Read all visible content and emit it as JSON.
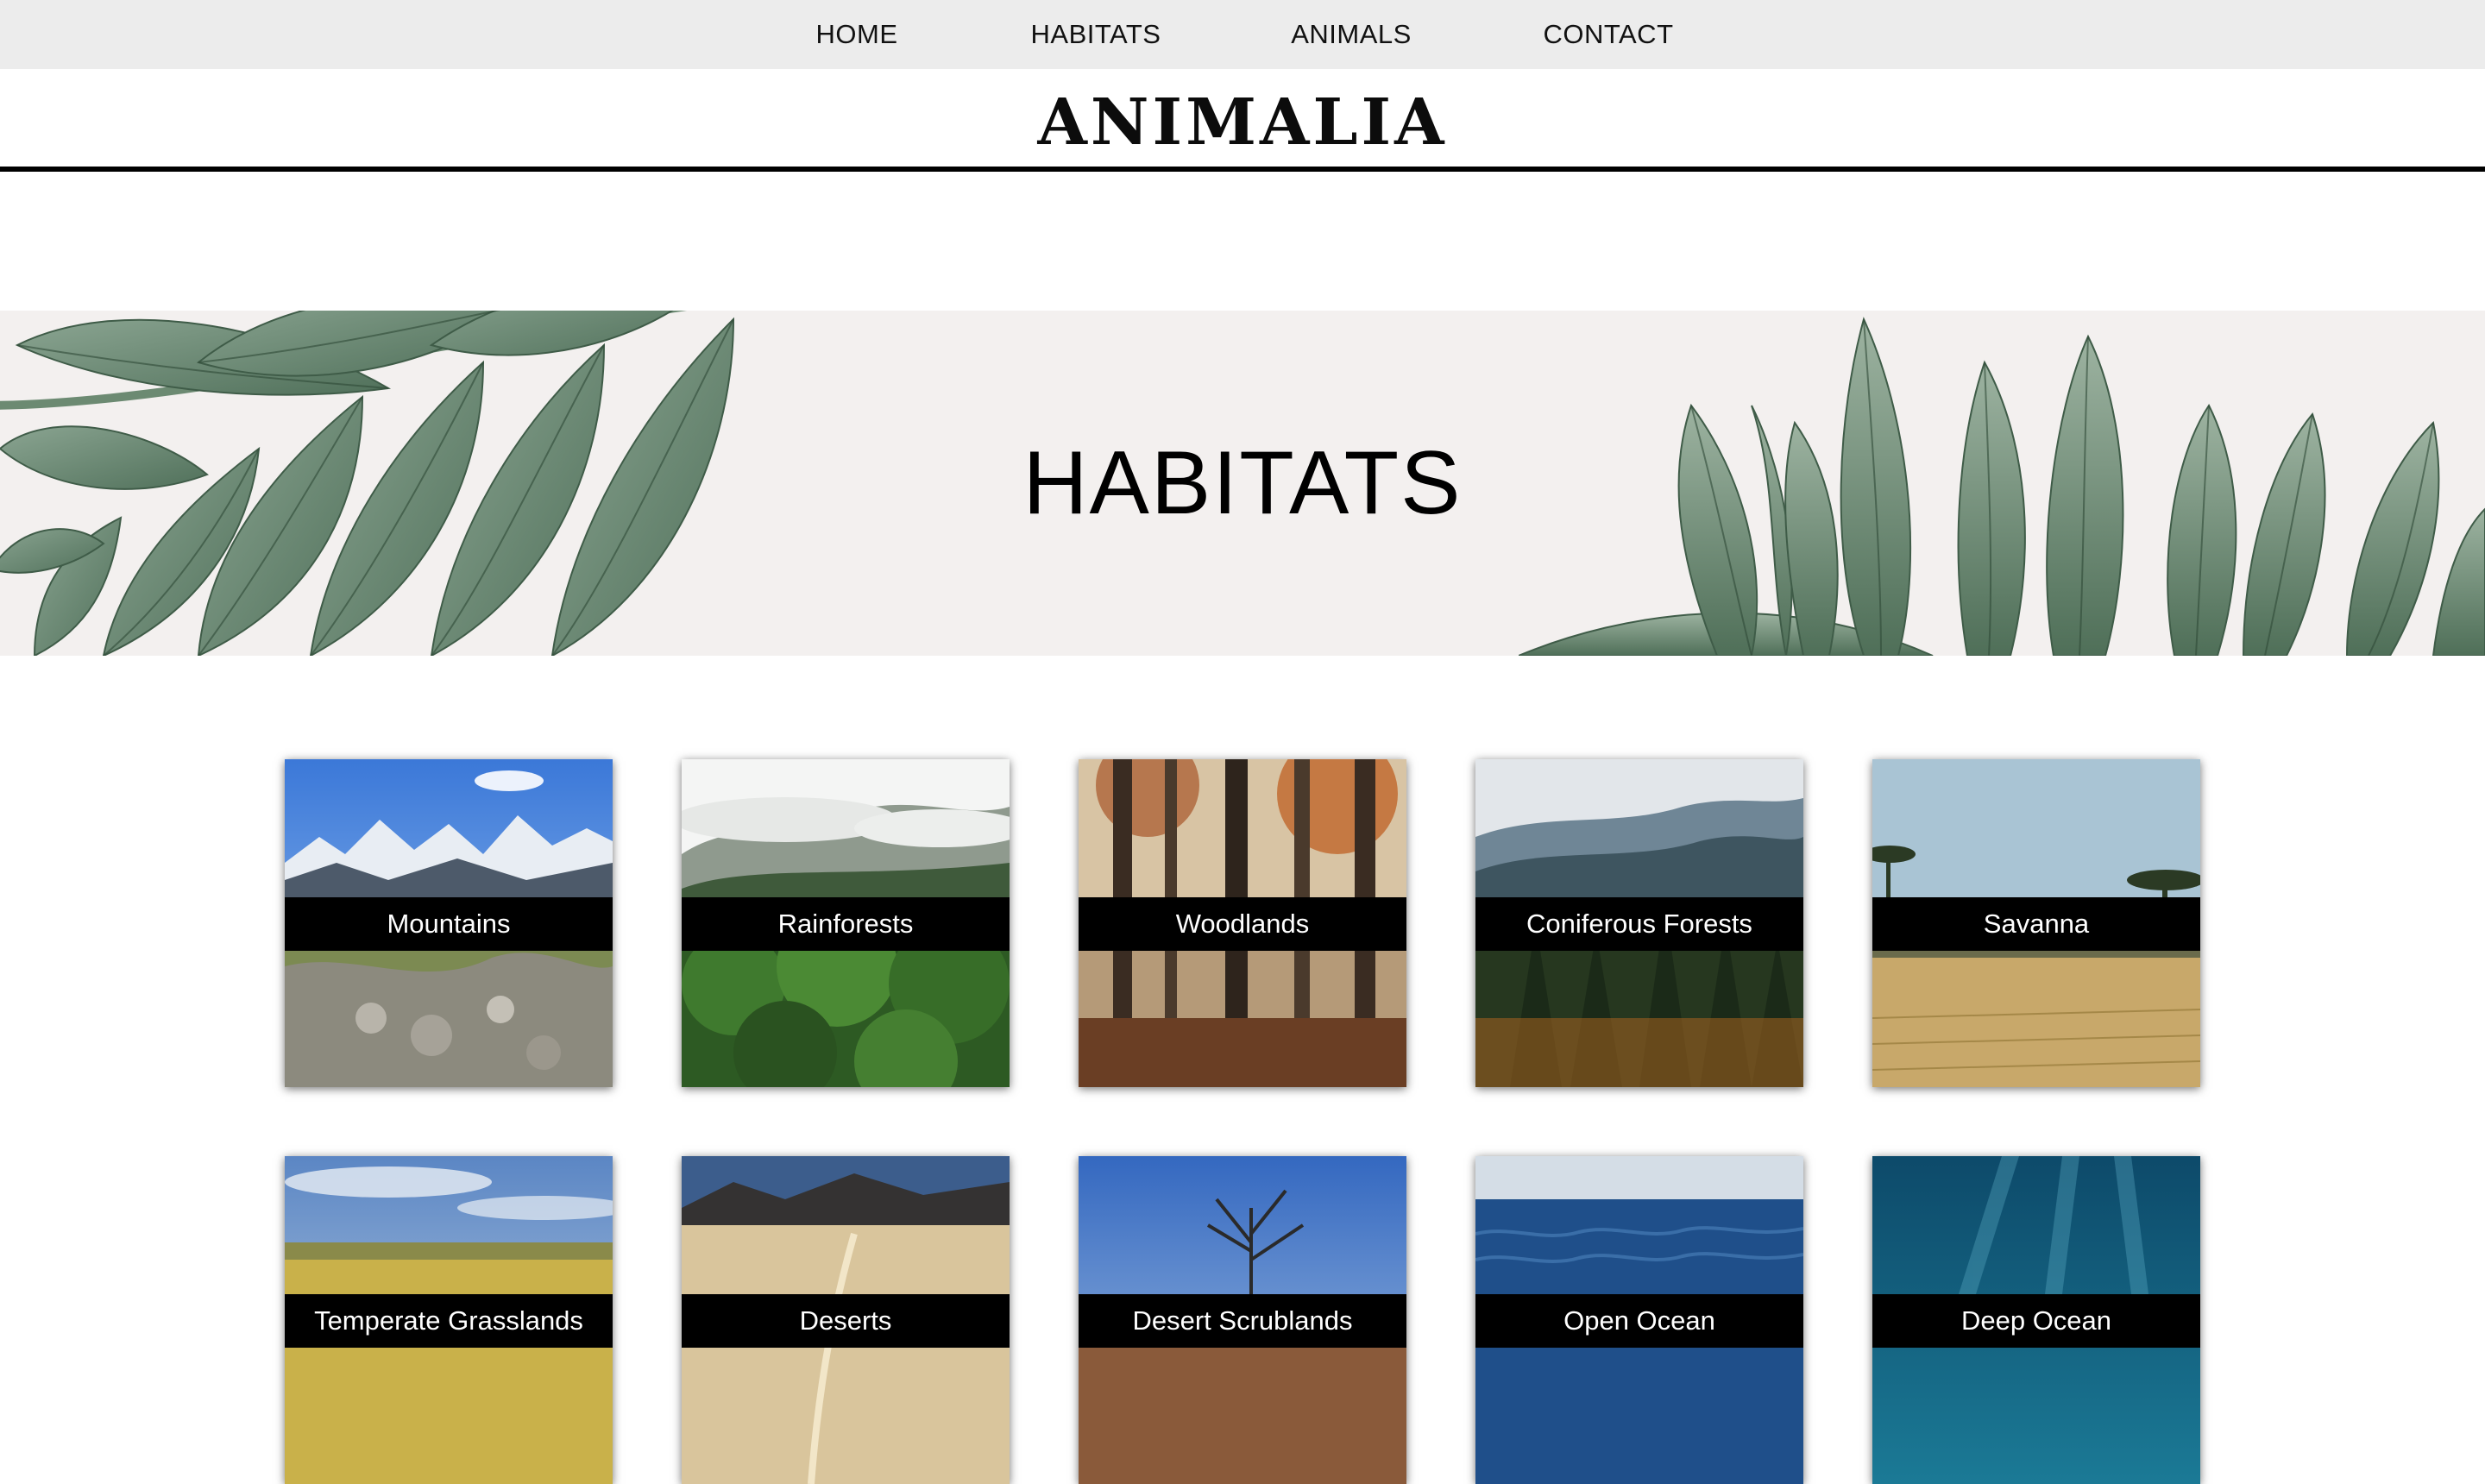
{
  "nav": {
    "items": [
      {
        "label": "HOME"
      },
      {
        "label": "HABITATS"
      },
      {
        "label": "ANIMALS"
      },
      {
        "label": "CONTACT"
      }
    ]
  },
  "header": {
    "logo": "ANIMALIA"
  },
  "hero": {
    "title": "HABITATS"
  },
  "colors": {
    "nav_bg": "#ececec",
    "hero_bg": "#f3f0ef",
    "leaf_green": "#6f8f74",
    "label_bg": "#000000",
    "label_text": "#ffffff"
  },
  "habitats": [
    {
      "label": "Mountains"
    },
    {
      "label": "Rainforests"
    },
    {
      "label": "Woodlands"
    },
    {
      "label": "Coniferous Forests"
    },
    {
      "label": "Savanna"
    },
    {
      "label": "Temperate Grasslands"
    },
    {
      "label": "Deserts"
    },
    {
      "label": "Desert Scrublands"
    },
    {
      "label": "Open Ocean"
    },
    {
      "label": "Deep Ocean"
    }
  ]
}
